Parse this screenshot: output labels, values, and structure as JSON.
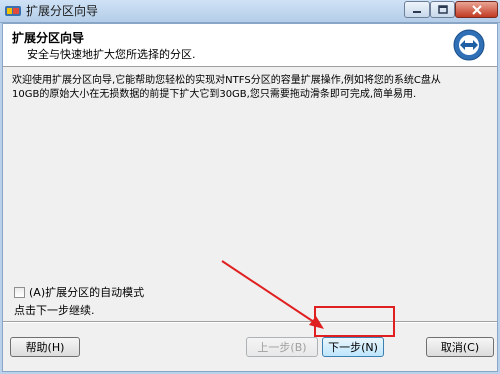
{
  "window": {
    "title": "扩展分区向导",
    "icons": {
      "app": "app-icon",
      "minimize": "minimize-icon",
      "maximize": "maximize-icon",
      "close": "close-icon"
    },
    "close_color": "#c23a22"
  },
  "header": {
    "title": "扩展分区向导",
    "subtitle": "安全与快速地扩大您所选择的分区.",
    "logo_icon": "expand-arrows-icon"
  },
  "body": {
    "description": "欢迎使用扩展分区向导,它能帮助您轻松的实现对NTFS分区的容量扩展操作,例如将您的系统C盘从10GB的原始大小在无损数据的前提下扩大它到30GB,您只需要拖动滑条即可完成,简单易用.",
    "auto_mode_label": "(A)扩展分区的自动模式",
    "auto_mode_checked": false,
    "hint": "点击下一步继续."
  },
  "footer": {
    "help_label": "帮助(H)",
    "back_label": "上一步(B)",
    "back_enabled": false,
    "next_label": "下一步(N)",
    "cancel_label": "取消(C)"
  },
  "annotation": {
    "color": "#e02020",
    "target": "next-button"
  }
}
